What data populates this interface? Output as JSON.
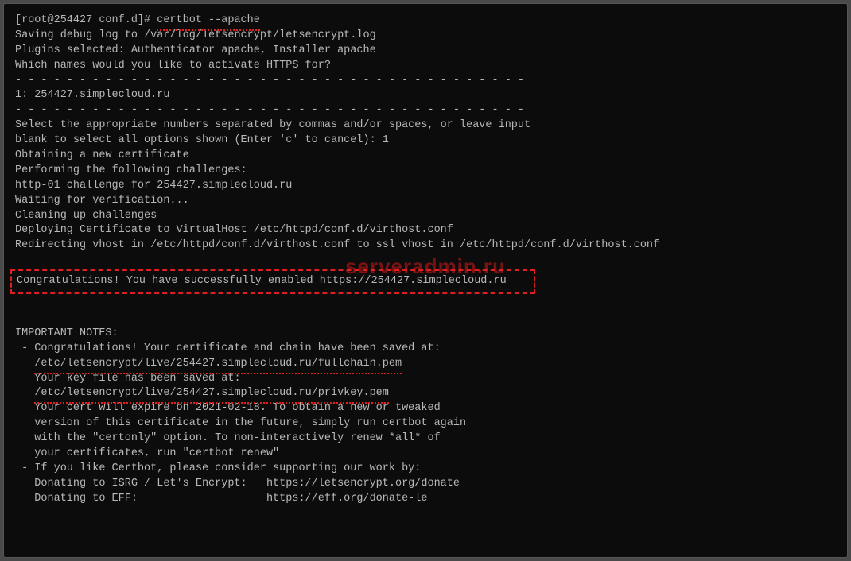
{
  "prompt": "[root@254427 conf.d]# ",
  "command": "certbot --apache",
  "l2": "Saving debug log to /var/log/letsencrypt/letsencrypt.log",
  "l3": "Plugins selected: Authenticator apache, Installer apache",
  "l4": "",
  "l5": "Which names would you like to activate HTTPS for?",
  "dash": "- - - - - - - - - - - - - - - - - - - - - - - - - - - - - - - - - - - - - - - -",
  "l6": "1: 254427.simplecloud.ru",
  "l7": "Select the appropriate numbers separated by commas and/or spaces, or leave input",
  "l8": "blank to select all options shown (Enter 'c' to cancel): 1",
  "l9": "Obtaining a new certificate",
  "l10": "Performing the following challenges:",
  "l11": "http-01 challenge for 254427.simplecloud.ru",
  "l12": "Waiting for verification...",
  "l13": "Cleaning up challenges",
  "l14": "Deploying Certificate to VirtualHost /etc/httpd/conf.d/virthost.conf",
  "l15": "Redirecting vhost in /etc/httpd/conf.d/virthost.conf to ssl vhost in /etc/httpd/conf.d/virthost.conf",
  "watermark": "serveradmin.ru",
  "congrats": "Congratulations! You have successfully enabled https://254427.simplecloud.ru",
  "notes_title": "IMPORTANT NOTES:",
  "n1": " - Congratulations! Your certificate and chain have been saved at:",
  "n2_pre": "   ",
  "n2_path": "/etc/letsencrypt/live/254427.simplecloud.ru/fullchain.pem",
  "n3": "   Your key file has been saved at:",
  "n4_pre": "   ",
  "n4_path": "/etc/letsencrypt/live/254427.simplecloud.ru/privkey.pem",
  "n5": "   Your cert will expire on 2021-02-18. To obtain a new or tweaked",
  "n6": "   version of this certificate in the future, simply run certbot again",
  "n7": "   with the \"certonly\" option. To non-interactively renew *all* of",
  "n8": "   your certificates, run \"certbot renew\"",
  "n9": " - If you like Certbot, please consider supporting our work by:",
  "n10": "",
  "n11": "   Donating to ISRG / Let's Encrypt:   https://letsencrypt.org/donate",
  "n12": "   Donating to EFF:                    https://eff.org/donate-le"
}
